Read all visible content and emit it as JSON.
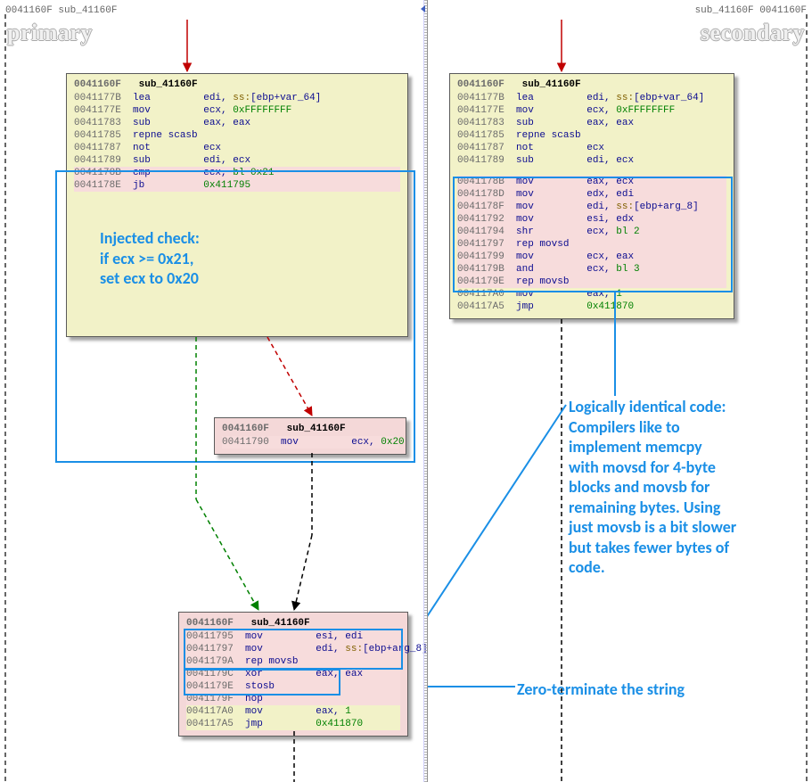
{
  "header": {
    "left_tag": "0041160F  sub_41160F",
    "right_tag": "sub_41160F  0041160F",
    "primary_label": "primary",
    "secondary_label": "secondary"
  },
  "left": {
    "block1": {
      "title_addr": "0041160F",
      "title_name": "sub_41160F",
      "rows": [
        {
          "addr": "0041177B",
          "mn": "lea",
          "ops": "edi, ",
          "seg": "ss:",
          "rest": "[ebp+var_64]",
          "cls": "yellow"
        },
        {
          "addr": "0041177E",
          "mn": "mov",
          "ops": "ecx, ",
          "hx": "0xFFFFFFFF",
          "cls": "yellow"
        },
        {
          "addr": "00411783",
          "mn": "sub",
          "ops": "eax, eax",
          "cls": "yellow"
        },
        {
          "addr": "00411785",
          "mn": "repne scasb",
          "ops": "",
          "cls": "yellow"
        },
        {
          "addr": "00411787",
          "mn": "not",
          "ops": "ecx",
          "cls": "yellow"
        },
        {
          "addr": "00411789",
          "mn": "sub",
          "ops": "edi, ecx",
          "cls": "yellow"
        },
        {
          "addr": "0041178B",
          "mn": "cmp",
          "ops": "ecx, ",
          "hx": "bl 0x21",
          "cls": "pink"
        },
        {
          "addr": "0041178E",
          "mn": "jb",
          "ops": "",
          "hx": "0x411795",
          "cls": "pink"
        }
      ]
    },
    "block2": {
      "title_addr": "0041160F",
      "title_name": "sub_41160F",
      "rows": [
        {
          "addr": "00411790",
          "mn": "mov",
          "ops": "ecx, ",
          "hx": "0x20",
          "cls": "pink"
        }
      ]
    },
    "block3": {
      "title_addr": "0041160F",
      "title_name": "sub_41160F",
      "rows": [
        {
          "addr": "00411795",
          "mn": "mov",
          "ops": "esi, edi",
          "cls": "pink"
        },
        {
          "addr": "00411797",
          "mn": "mov",
          "ops": "edi, ",
          "seg": "ss:",
          "rest": "[ebp+arg_8]",
          "cls": "pink"
        },
        {
          "addr": "0041179A",
          "mn": "rep movsb",
          "ops": "",
          "cls": "pink"
        },
        {
          "addr": "0041179C",
          "mn": "xor",
          "ops": "eax, eax",
          "cls": "pink"
        },
        {
          "addr": "0041179E",
          "mn": "stosb",
          "ops": "",
          "cls": "pink"
        },
        {
          "addr": "0041179F",
          "mn": "nop",
          "ops": "",
          "cls": "pink"
        },
        {
          "addr": "004117A0",
          "mn": "mov",
          "ops": "eax, ",
          "hx": "1",
          "cls": "yellow"
        },
        {
          "addr": "004117A5",
          "mn": "jmp",
          "ops": "",
          "hx": "0x411870",
          "cls": "yellow"
        }
      ]
    }
  },
  "right": {
    "block1": {
      "title_addr": "0041160F",
      "title_name": "sub_41160F",
      "rows": [
        {
          "addr": "0041177B",
          "mn": "lea",
          "ops": "edi, ",
          "seg": "ss:",
          "rest": "[ebp+var_64]",
          "cls": "yellow"
        },
        {
          "addr": "0041177E",
          "mn": "mov",
          "ops": "ecx, ",
          "hx": "0xFFFFFFFF",
          "cls": "yellow"
        },
        {
          "addr": "00411783",
          "mn": "sub",
          "ops": "eax, eax",
          "cls": "yellow"
        },
        {
          "addr": "00411785",
          "mn": "repne scasb",
          "ops": "",
          "cls": "yellow"
        },
        {
          "addr": "00411787",
          "mn": "not",
          "ops": "ecx",
          "cls": "yellow"
        },
        {
          "addr": "00411789",
          "mn": "sub",
          "ops": "edi, ecx",
          "cls": "yellow"
        },
        {
          "gap": true
        },
        {
          "addr": "0041178B",
          "mn": "mov",
          "ops": "eax, ecx",
          "cls": "pink"
        },
        {
          "addr": "0041178D",
          "mn": "mov",
          "ops": "edx, edi",
          "cls": "pink"
        },
        {
          "addr": "0041178F",
          "mn": "mov",
          "ops": "edi, ",
          "seg": "ss:",
          "rest": "[ebp+arg_8]",
          "cls": "pink"
        },
        {
          "addr": "00411792",
          "mn": "mov",
          "ops": "esi, edx",
          "cls": "pink"
        },
        {
          "addr": "00411794",
          "mn": "shr",
          "ops": "ecx, ",
          "hx": "bl 2",
          "cls": "pink"
        },
        {
          "addr": "00411797",
          "mn": "rep movsd",
          "ops": "",
          "cls": "pink"
        },
        {
          "addr": "00411799",
          "mn": "mov",
          "ops": "ecx, eax",
          "cls": "pink"
        },
        {
          "addr": "0041179B",
          "mn": "and",
          "ops": "ecx, ",
          "hx": "bl 3",
          "cls": "pink"
        },
        {
          "addr": "0041179E",
          "mn": "rep movsb",
          "ops": "",
          "cls": "pink"
        },
        {
          "addr": "004117A0",
          "mn": "mov",
          "ops": "eax, ",
          "hx": "1",
          "cls": "yellow"
        },
        {
          "addr": "004117A5",
          "mn": "jmp",
          "ops": "",
          "hx": "0x411870",
          "cls": "yellow"
        }
      ]
    }
  },
  "annotations": {
    "injected": "Injected check:\nif ecx >= 0x21,\nset ecx to 0x20",
    "memcpy": "Logically identical code:\nCompilers like to\nimplement memcpy\nwith movsd for 4-byte\nblocks and movsb for\nremaining bytes. Using\njust movsb is a bit slower\nbut takes fewer bytes of\ncode.",
    "zeroterm": "Zero-terminate the string"
  }
}
